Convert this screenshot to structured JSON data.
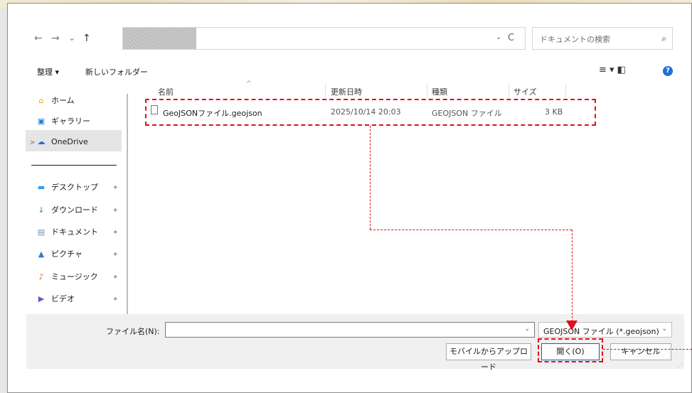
{
  "nav": {
    "back": "←",
    "forward": "→",
    "dropdown": "⌄",
    "up": "↑",
    "refresh": "C",
    "addr_chevron": "⌄"
  },
  "search": {
    "placeholder": "ドキュメントの検索",
    "icon": "⌕"
  },
  "toolbar": {
    "organize": "整理 ▾",
    "new_folder": "新しいフォルダー",
    "view_icons": "≡ ▾  ◧",
    "help": "?"
  },
  "sidebar": {
    "items": [
      {
        "label": "ホーム",
        "icon": "⌂",
        "color": "#e6a317"
      },
      {
        "label": "ギャラリー",
        "icon": "▣",
        "color": "#2a7bd4"
      },
      {
        "label": "OneDrive",
        "icon": "☁",
        "color": "#1e6fd9"
      },
      {
        "label": "デスクトップ",
        "icon": "▬",
        "color": "#2a9df4"
      },
      {
        "label": "ダウンロード",
        "icon": "↓",
        "color": "#2a9d4a"
      },
      {
        "label": "ドキュメント",
        "icon": "▤",
        "color": "#6f8fb0"
      },
      {
        "label": "ピクチャ",
        "icon": "▲",
        "color": "#2a7bd4"
      },
      {
        "label": "ミュージック",
        "icon": "♪",
        "color": "#e0552a"
      },
      {
        "label": "ビデオ",
        "icon": "▶",
        "color": "#7a4fd4"
      }
    ],
    "pin": "📌",
    "expander": ">"
  },
  "columns": {
    "name": "名前",
    "modified": "更新日時",
    "type": "種類",
    "size": "サイズ",
    "sort_caret": "^"
  },
  "files": [
    {
      "name": "GeoJSONファイル.geojson",
      "modified": "2025/10/14 20:03",
      "type": "GEOJSON ファイル",
      "size": "3 KB"
    }
  ],
  "bottom": {
    "filename_label": "ファイル名(N):",
    "filename_value": "",
    "filter": "GEOJSON ファイル (*.geojson)",
    "upload_button": "モバイルからアップロード",
    "open_button": "開く(O)",
    "cancel_button": "キャンセル"
  },
  "colors": {
    "annotation": "#e0101a",
    "accent": "#1e6fd9"
  }
}
